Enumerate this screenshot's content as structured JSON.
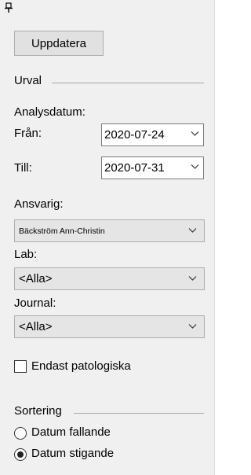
{
  "toolbar": {
    "update_label": "Uppdatera"
  },
  "selection": {
    "group_title": "Urval",
    "analysis_date_label": "Analysdatum:",
    "from_label": "Från:",
    "from_value": "2020-07-24",
    "to_label": "Till:",
    "to_value": "2020-07-31",
    "responsible_label": "Ansvarig:",
    "responsible_value": "Bäckström Ann-Christin",
    "lab_label": "Lab:",
    "lab_value": "<Alla>",
    "journal_label": "Journal:",
    "journal_value": "<Alla>",
    "pathological_only_label": "Endast patologiska",
    "pathological_only_checked": false
  },
  "sorting": {
    "group_title": "Sortering",
    "options": [
      {
        "label": "Datum fallande",
        "selected": false
      },
      {
        "label": "Datum stigande",
        "selected": true
      }
    ]
  },
  "icons": {
    "pin": "pin-icon",
    "dropdown": "chevron-down-icon"
  }
}
